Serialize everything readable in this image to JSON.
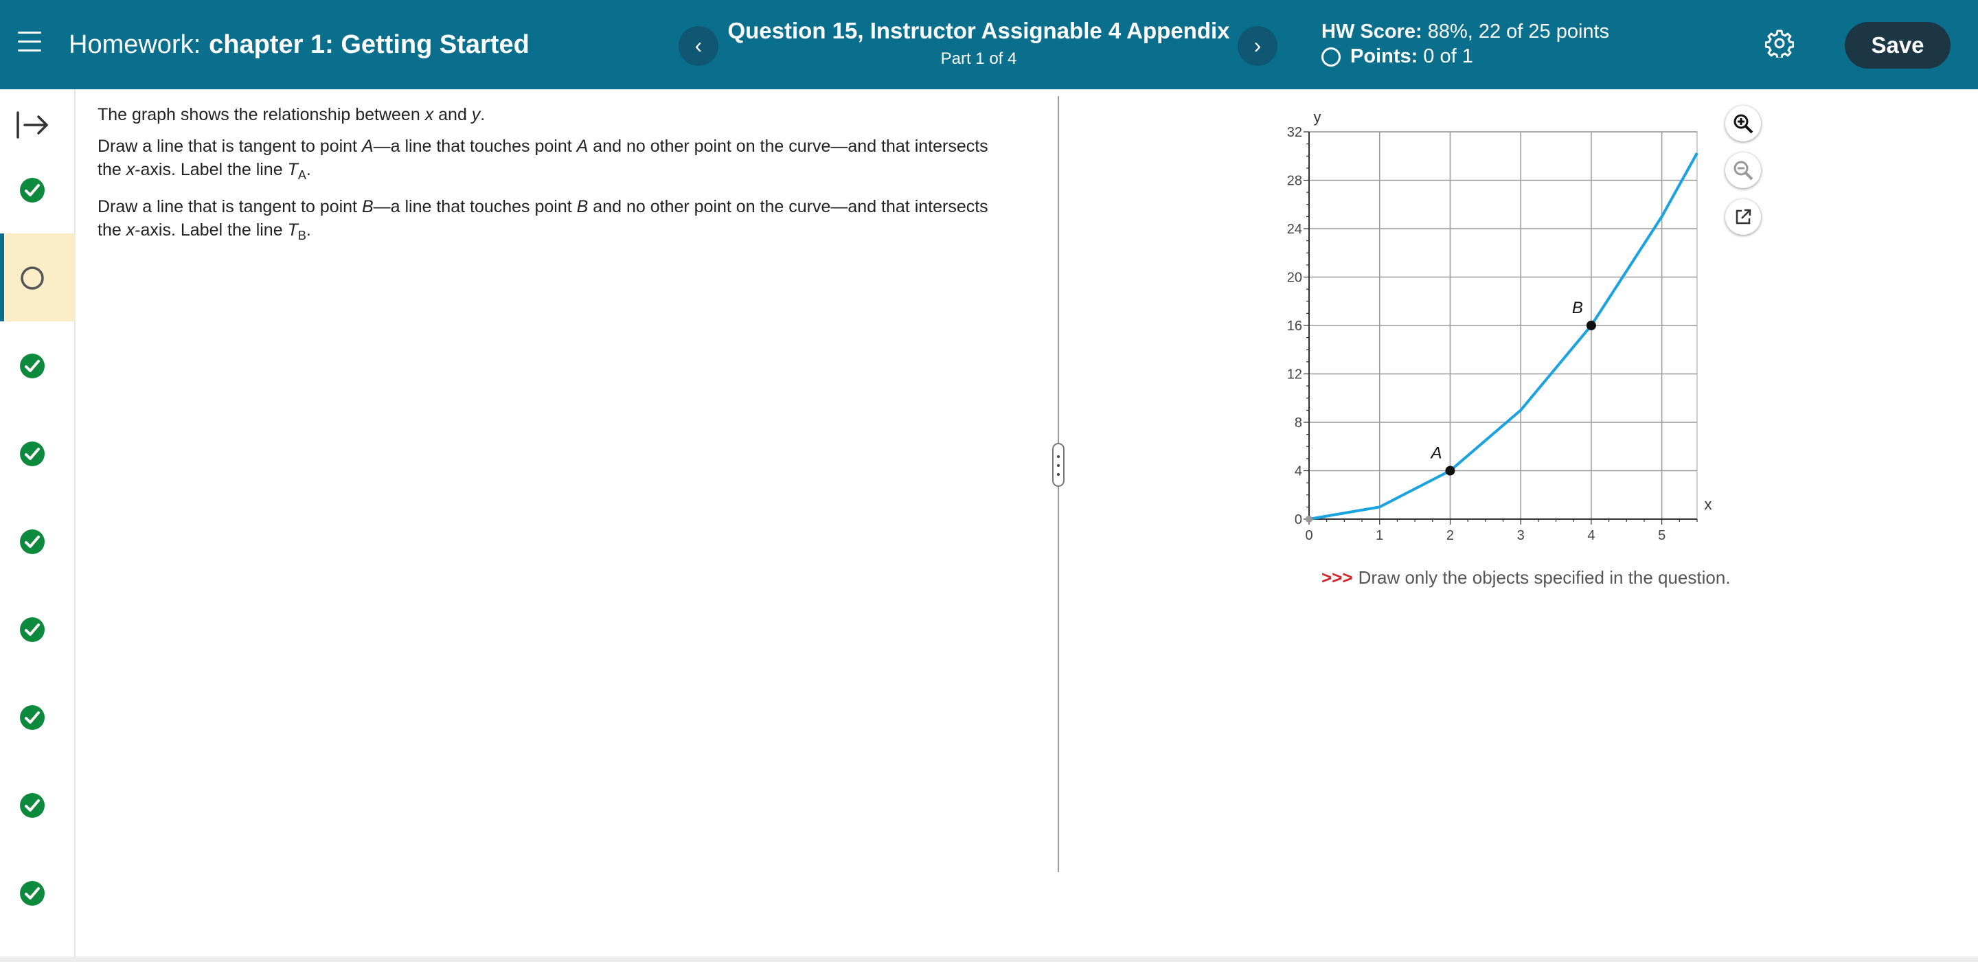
{
  "header": {
    "homework_prefix": "Homework:",
    "homework_name": "chapter 1: Getting Started",
    "question_title": "Question 15, Instructor Assignable 4 Appendix",
    "part": "Part 1 of 4",
    "prev_label": "‹",
    "next_label": "›",
    "hw_score_label": "HW Score:",
    "hw_score_value": "88%, 22 of 25 points",
    "points_label": "Points:",
    "points_value": "0 of 1",
    "save_label": "Save"
  },
  "sidebar": {
    "items": [
      {
        "status": "complete"
      },
      {
        "status": "current"
      },
      {
        "status": "complete"
      },
      {
        "status": "complete"
      },
      {
        "status": "complete"
      },
      {
        "status": "complete"
      },
      {
        "status": "complete"
      },
      {
        "status": "complete"
      },
      {
        "status": "complete"
      }
    ]
  },
  "question": {
    "p1_a": "The graph shows the relationship between ",
    "p1_x": "x",
    "p1_b": " and ",
    "p1_y": "y",
    "p1_c": ".",
    "p2_a": "Draw a line that is tangent to point ",
    "p2_pt": "A",
    "p2_b": "—a line that touches point ",
    "p2_pt2": "A",
    "p2_c": " and no other point on the curve—and that intersects the ",
    "p2_x": "x",
    "p2_d": "-axis. Label the line ",
    "p2_T": "T",
    "p2_sub": "A",
    "p2_e": ".",
    "p3_a": "Draw a line that is tangent to point ",
    "p3_pt": "B",
    "p3_b": "—a line that touches point ",
    "p3_pt2": "B",
    "p3_c": " and no other point on the curve—and that intersects the ",
    "p3_x": "x",
    "p3_d": "-axis. Label the line ",
    "p3_T": "T",
    "p3_sub": "B",
    "p3_e": "."
  },
  "chart_data": {
    "type": "line",
    "xlabel": "x",
    "ylabel": "y",
    "xlim": [
      0,
      5.5
    ],
    "ylim": [
      0,
      32
    ],
    "x_ticks": [
      0,
      1,
      2,
      3,
      4,
      5
    ],
    "y_ticks": [
      0,
      4,
      8,
      12,
      16,
      20,
      24,
      28,
      32
    ],
    "grid": true,
    "series": [
      {
        "color": "#1aa3e0",
        "x": [
          0,
          1,
          2,
          3,
          4,
          5,
          5.5
        ],
        "y": [
          0,
          1,
          4,
          9,
          16,
          25,
          30.25
        ]
      }
    ],
    "points": [
      {
        "label": "A",
        "x": 2,
        "y": 4
      },
      {
        "label": "B",
        "x": 4,
        "y": 16
      }
    ]
  },
  "instruction": {
    "arrows": ">>>",
    "text": "Draw only the objects specified in the question."
  }
}
